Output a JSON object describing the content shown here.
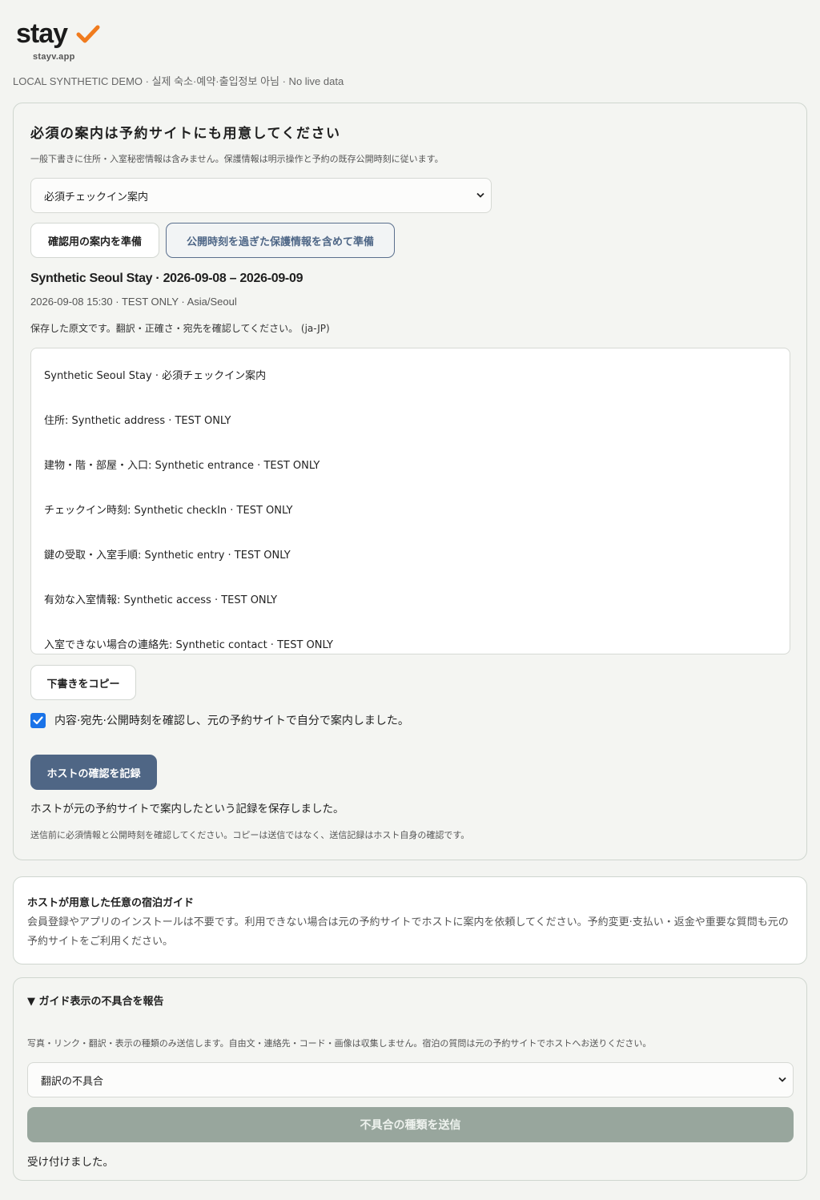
{
  "brand": {
    "logo_text": "stay",
    "domain": "stayv.app",
    "accent_color": "#f07b1e"
  },
  "banner": "LOCAL SYNTHETIC DEMO · 실제 숙소·예약·출입정보 아님 · No live data",
  "notice_card": {
    "title": "必須の案内は予約サイトにも用意してください",
    "subtitle": "一般下書きに住所・入室秘密情報は含みません。保護情報は明示操作と予約の既存公開時刻に従います。",
    "template_select": {
      "selected": "必須チェックイン案内"
    },
    "prepare_button": "確認用の案内を準備",
    "prepare_protected_button": "公開時刻を過ぎた保護情報を含めて準備",
    "stay_title": "Synthetic Seoul Stay · 2026-09-08 – 2026-09-09",
    "stay_meta": "2026-09-08 15:30 · TEST ONLY · Asia/Seoul",
    "original_note": "保存した原文です。翻訳・正確さ・宛先を確認してください。 (ja-JP)",
    "draft_lines": [
      "Synthetic Seoul Stay · 必須チェックイン案内",
      "住所: Synthetic address · TEST ONLY",
      "建物・階・部屋・入口: Synthetic entrance · TEST ONLY",
      "チェックイン時刻: Synthetic checkIn · TEST ONLY",
      "鍵の受取・入室手順: Synthetic entry · TEST ONLY",
      "有効な入室情報: Synthetic access · TEST ONLY",
      "入室できない場合の連絡先: Synthetic contact · TEST ONLY"
    ],
    "copy_button": "下書きをコピー",
    "confirm_checkbox": {
      "checked": true,
      "label": "内容·宛先·公開時刻を確認し、元の予約サイトで自分で案内しました。"
    },
    "record_button": "ホストの確認を記録",
    "record_status": "ホストが元の予約サイトで案内したという記録を保存しました。",
    "footer_note": "送信前に必須情報と公開時刻を確認してください。コピーは送信ではなく、送信記録はホスト自身の確認です。"
  },
  "guide_card": {
    "title": "ホストが用意した任意の宿泊ガイド",
    "body": "会員登録やアプリのインストールは不要です。利用できない場合は元の予約サイトでホストに案内を依頼してください。予約変更·支払い・返金や重要な質問も元の予約サイトをご利用ください。"
  },
  "report_card": {
    "summary": "▼ ガイド表示の不具合を報告",
    "note": "写真・リンク・翻訳・表示の種類のみ送信します。自由文・連絡先・コード・画像は収集しません。宿泊の質問は元の予約サイトでホストへお送りください。",
    "type_select": {
      "selected": "翻訳の不具合"
    },
    "submit_button": "不具合の種類を送信",
    "status": "受け付けました。"
  }
}
